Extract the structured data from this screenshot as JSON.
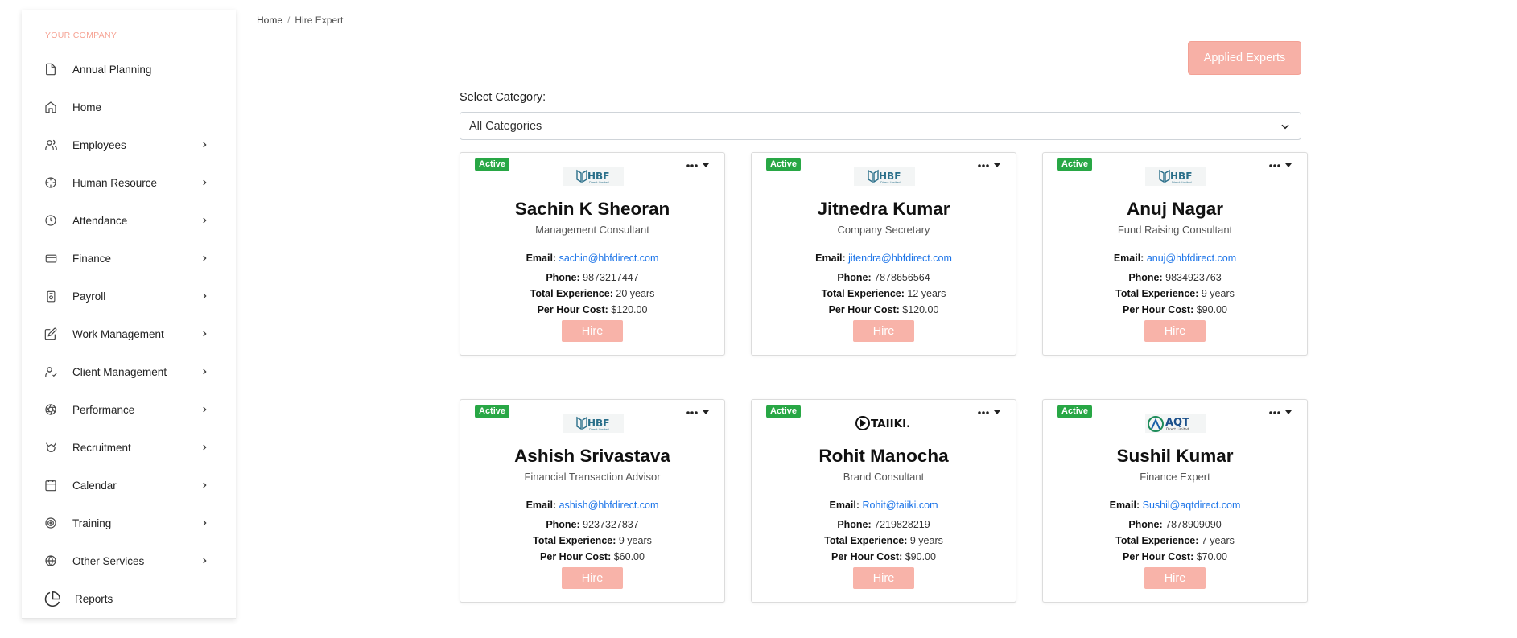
{
  "company": "YOUR COMPANY",
  "sidebar": {
    "items": [
      {
        "label": "Annual Planning",
        "icon": "file-icon",
        "chevron": false
      },
      {
        "label": "Home",
        "icon": "home-icon",
        "chevron": false
      },
      {
        "label": "Employees",
        "icon": "users-icon",
        "chevron": true
      },
      {
        "label": "Human Resource",
        "icon": "crosshair-icon",
        "chevron": true
      },
      {
        "label": "Attendance",
        "icon": "clock-icon",
        "chevron": true
      },
      {
        "label": "Finance",
        "icon": "credit-card-icon",
        "chevron": true
      },
      {
        "label": "Payroll",
        "icon": "payroll-icon",
        "chevron": true
      },
      {
        "label": "Work Management",
        "icon": "edit-icon",
        "chevron": true
      },
      {
        "label": "Client Management",
        "icon": "user-check-icon",
        "chevron": true
      },
      {
        "label": "Performance",
        "icon": "aperture-icon",
        "chevron": true
      },
      {
        "label": "Recruitment",
        "icon": "recruitment-icon",
        "chevron": true
      },
      {
        "label": "Calendar",
        "icon": "calendar-icon",
        "chevron": true
      },
      {
        "label": "Training",
        "icon": "target-icon",
        "chevron": true
      },
      {
        "label": "Other Services",
        "icon": "globe-icon",
        "chevron": true
      },
      {
        "label": "Reports",
        "icon": "pie-chart-icon",
        "chevron": false
      }
    ]
  },
  "breadcrumb": {
    "home": "Home",
    "separator": "/",
    "current": "Hire Expert"
  },
  "applied_button": "Applied Experts",
  "category": {
    "label": "Select Category:",
    "selected": "All Categories"
  },
  "labels": {
    "email": "Email:",
    "phone": "Phone:",
    "experience": "Total Experience:",
    "cost": "Per Hour Cost:",
    "hire": "Hire",
    "status": "Active"
  },
  "experts": [
    {
      "name": "Sachin K Sheoran",
      "role": "Management Consultant",
      "email": "sachin@hbfdirect.com",
      "phone": "9873217447",
      "experience": "20 years",
      "cost": "$120.00",
      "logo": "HBF"
    },
    {
      "name": "Jitnedra Kumar",
      "role": "Company Secretary",
      "email": "jitendra@hbfdirect.com",
      "phone": "7878656564",
      "experience": "12 years",
      "cost": "$120.00",
      "logo": "HBF"
    },
    {
      "name": "Anuj Nagar",
      "role": "Fund Raising Consultant",
      "email": "anuj@hbfdirect.com",
      "phone": "9834923763",
      "experience": "9 years",
      "cost": "$90.00",
      "logo": "HBF"
    },
    {
      "name": "Ashish Srivastava",
      "role": "Financial Transaction Advisor",
      "email": "ashish@hbfdirect.com",
      "phone": "9237327837",
      "experience": "9 years",
      "cost": "$60.00",
      "logo": "HBF"
    },
    {
      "name": "Rohit Manocha",
      "role": "Brand Consultant",
      "email": "Rohit@taiiki.com",
      "phone": "7219828219",
      "experience": "9 years",
      "cost": "$90.00",
      "logo": "TAIIKI"
    },
    {
      "name": "Sushil Kumar",
      "role": "Finance Expert",
      "email": "Sushil@aqtdirect.com",
      "phone": "7878909090",
      "experience": "7 years",
      "cost": "$70.00",
      "logo": "AQT"
    }
  ],
  "colors": {
    "accent": "#f7b0a6",
    "active_badge": "#28a745",
    "link": "#1a73e8"
  }
}
